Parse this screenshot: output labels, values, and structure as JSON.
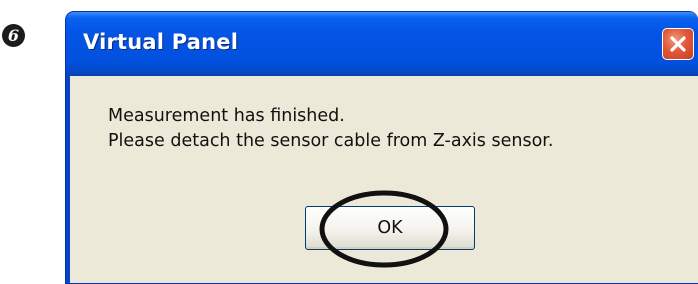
{
  "step_marker": "6",
  "dialog": {
    "title": "Virtual Panel",
    "close_icon": "close-icon",
    "message_lines": [
      "Measurement has finished.",
      "Please detach the sensor cable from Z-axis sensor."
    ],
    "ok_button_label": "OK"
  },
  "colors": {
    "title_bar": "#0352e1",
    "close_button": "#e2583b",
    "client_area": "#ece9d8",
    "annotation_ellipse": "#111111"
  }
}
